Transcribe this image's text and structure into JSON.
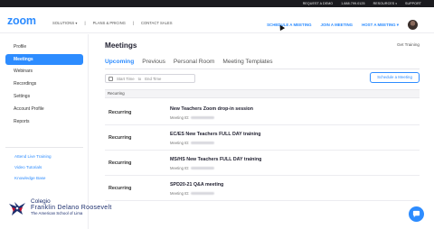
{
  "topbar": {
    "request_demo": "REQUEST A DEMO",
    "phone": "1.888.799.0125",
    "resources": "RESOURCES",
    "support": "SUPPORT"
  },
  "nav": {
    "logo": "zoom",
    "links": [
      "SOLUTIONS",
      "PLANS & PRICING",
      "CONTACT SALES"
    ],
    "actions": [
      "SCHEDULE A MEETING",
      "JOIN A MEETING",
      "HOST A MEETING"
    ],
    "brand_color": "#2d8cff"
  },
  "sidebar": {
    "items": [
      {
        "label": "Profile",
        "active": false
      },
      {
        "label": "Meetings",
        "active": true
      },
      {
        "label": "Webinars",
        "active": false
      },
      {
        "label": "Recordings",
        "active": false
      },
      {
        "label": "Settings",
        "active": false
      },
      {
        "label": "Account Profile",
        "active": false
      },
      {
        "label": "Reports",
        "active": false
      }
    ],
    "links": [
      "Attend Live Training",
      "Video Tutorials",
      "Knowledge Base"
    ]
  },
  "school": {
    "line1": "Colegio",
    "line2": "Franklin Delano Roosevelt",
    "line3": "The American School of Lima"
  },
  "main": {
    "title": "Meetings",
    "get_training": "Get Training",
    "tabs": [
      {
        "label": "Upcoming",
        "active": true
      },
      {
        "label": "Previous",
        "active": false
      },
      {
        "label": "Personal Room",
        "active": false
      },
      {
        "label": "Meeting Templates",
        "active": false
      }
    ],
    "start_time": "Start Time",
    "to": "to",
    "end_time": "End Time",
    "schedule_button": "Schedule a Meeting",
    "section_header": "Recurring",
    "meeting_id_label": "Meeting ID:",
    "meetings": [
      {
        "kind": "Recurring",
        "topic": "New Teachers Zoom drop-in session"
      },
      {
        "kind": "Recurring",
        "topic": "EC/ES New Teachers FULL DAY training"
      },
      {
        "kind": "Recurring",
        "topic": "MS/HS New Teachers FULL DAY training"
      },
      {
        "kind": "Recurring",
        "topic": "SPD20-21 Q&A meeting"
      }
    ]
  },
  "icons": {
    "chat": "chat-bubble-icon",
    "calendar": "calendar-icon",
    "avatar": "user-avatar",
    "dropdown": "caret-down-icon"
  }
}
